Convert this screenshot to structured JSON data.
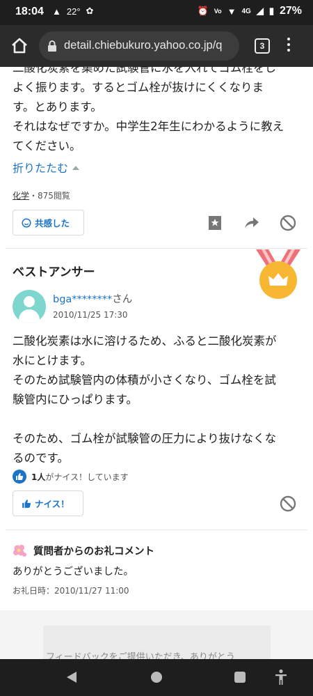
{
  "status_bar": {
    "time": "18:04",
    "alert": "▲",
    "temperature": "22°",
    "network": "4G",
    "battery": "27%"
  },
  "browser": {
    "url": "detail.chiebukuro.yahoo.co.jp/q",
    "tab_count": "3"
  },
  "question": {
    "text_lines": [
      "二酸化炭素を集めた試験管に水を入れてゴム栓をし",
      "よく振ります。するとゴム栓が抜けにくくなりま",
      "す。とあります。",
      "それはなぜですか。中学生2年生にわかるように教え",
      "てください。"
    ],
    "collapse_label": "折りたたむ",
    "category": "化学",
    "views": "・875閲覧",
    "empathy_label": "共感した"
  },
  "best_answer": {
    "title": "ベストアンサー",
    "user": "bga********",
    "honorific": "さん",
    "date": "2010/11/25 17:30",
    "text": "二酸化炭素は水に溶けるため、ふると二酸化炭素が\n水にとけます。\nそのため試験管内の体積が小さくなり、ゴム栓を試\n験管内にひっぱります。\n\nそのため、ゴム栓が試験管の圧力により抜けなくな\nるのです。",
    "like_count": "1人",
    "like_suffix": "がナイス！しています",
    "nice_label": "ナイス！"
  },
  "thanks": {
    "title": "質問者からのお礼コメント",
    "text": "ありがとうございました。",
    "date": "お礼日時：2010/11/27 11:00"
  },
  "feedback": {
    "text": "フィードバックをご提供いただき、ありがとう"
  },
  "colors": {
    "link": "#1a73c8",
    "medal_ribbon": "#f0707a",
    "medal_gold": "#f7b733"
  }
}
